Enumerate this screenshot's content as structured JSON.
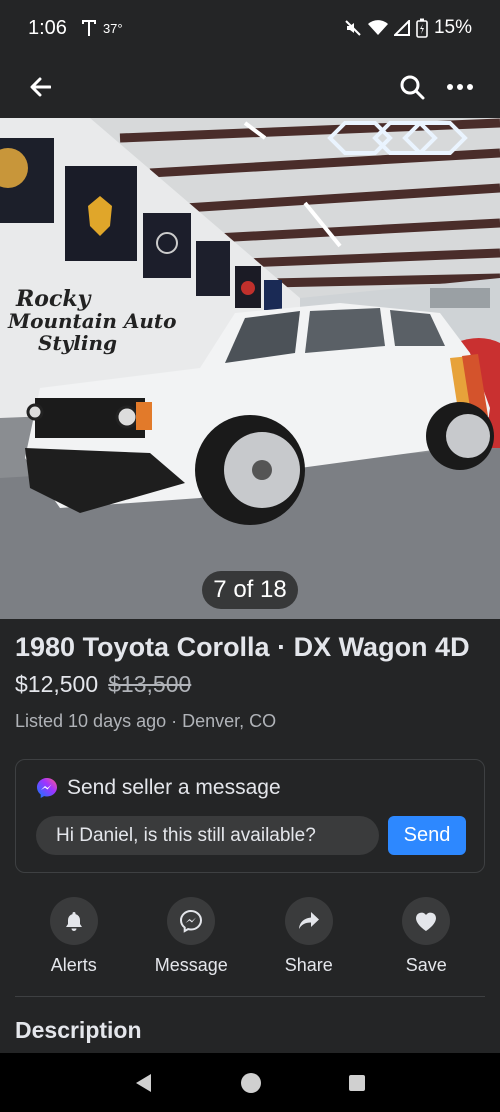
{
  "status": {
    "time": "1:06",
    "temperature": "37°",
    "battery": "15%",
    "icons": [
      "mute-icon",
      "wifi-icon",
      "signal-icon",
      "battery-icon"
    ]
  },
  "app_bar": {
    "icons": [
      "back-arrow-icon",
      "search-icon",
      "more-icon"
    ]
  },
  "photo": {
    "counter": "7 of 18",
    "sign_text": "Rocky Mountain Auto Styling"
  },
  "listing": {
    "title": "1980 Toyota Corolla · DX Wagon 4D",
    "price": "$12,500",
    "original_price": "$13,500",
    "meta": "Listed 10 days ago · Denver, CO"
  },
  "message": {
    "heading": "Send seller a message",
    "input_value": "Hi Daniel, is this still available?",
    "send_label": "Send"
  },
  "actions": [
    {
      "label": "Alerts",
      "icon": "bell-icon"
    },
    {
      "label": "Message",
      "icon": "messenger-icon"
    },
    {
      "label": "Share",
      "icon": "share-icon"
    },
    {
      "label": "Save",
      "icon": "heart-icon"
    }
  ],
  "description": {
    "heading": "Description"
  },
  "colors": {
    "background": "#242526",
    "accent": "#2d88ff",
    "text": "#e4e6eb",
    "muted": "#b0b3b8"
  }
}
